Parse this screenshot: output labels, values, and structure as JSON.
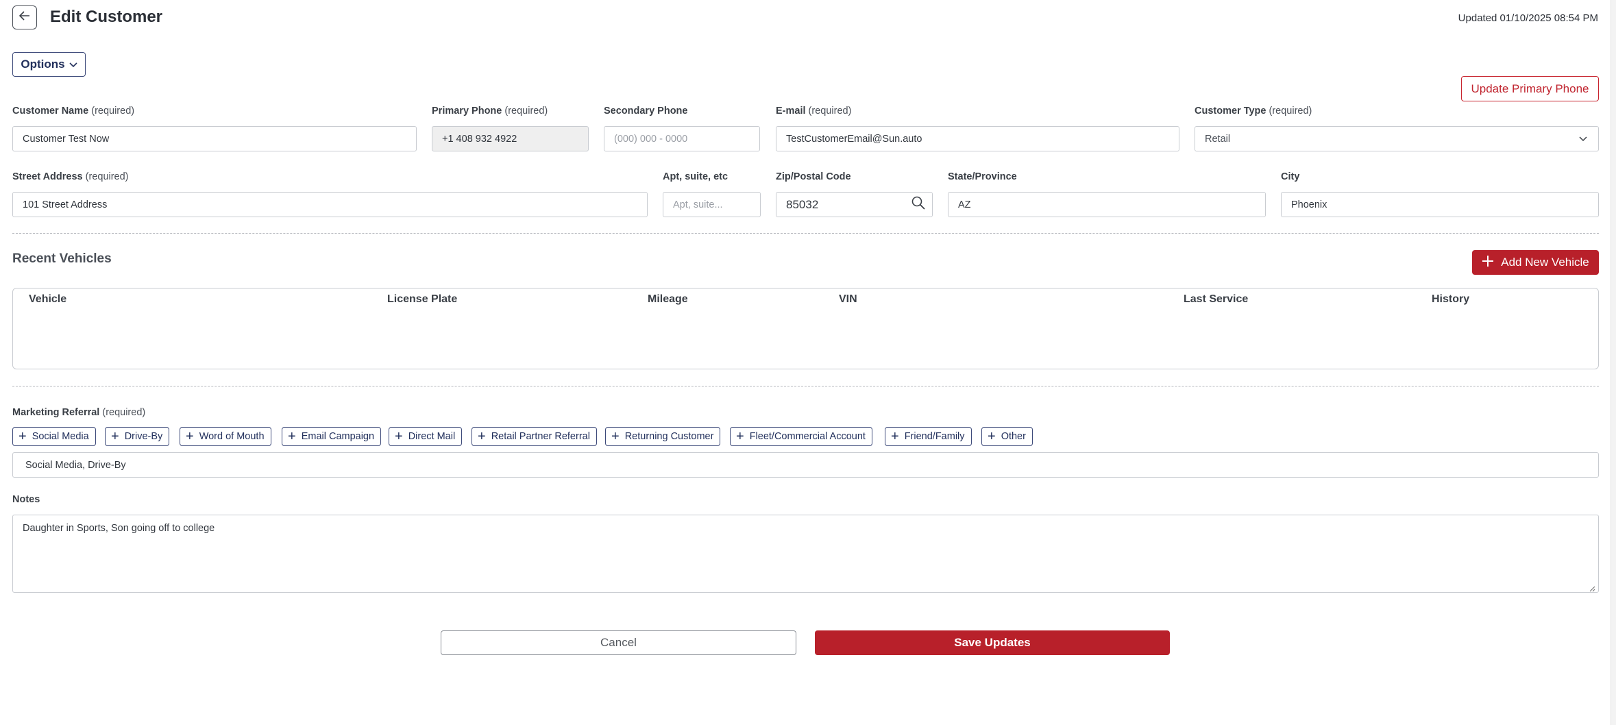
{
  "header": {
    "title": "Edit Customer",
    "updated": "Updated 01/10/2025 08:54 PM",
    "options_label": "Options",
    "update_phone_label": "Update Primary Phone"
  },
  "form": {
    "customer_name": {
      "label": "Customer Name",
      "req": "(required)",
      "value": "Customer Test Now"
    },
    "primary_phone": {
      "label": "Primary Phone",
      "req": "(required)",
      "value": "+1 408 932 4922"
    },
    "secondary_phone": {
      "label": "Secondary Phone",
      "placeholder": "(000) 000 - 0000"
    },
    "email": {
      "label": "E-mail",
      "req": "(required)",
      "value": "TestCustomerEmail@Sun.auto"
    },
    "customer_type": {
      "label": "Customer Type",
      "req": "(required)",
      "value": "Retail"
    },
    "street": {
      "label": "Street Address",
      "req": "(required)",
      "value": "101 Street Address"
    },
    "apt": {
      "label": "Apt, suite, etc",
      "placeholder": "Apt, suite..."
    },
    "zip": {
      "label": "Zip/Postal Code",
      "value": "85032"
    },
    "state": {
      "label": "State/Province",
      "value": "AZ"
    },
    "city": {
      "label": "City",
      "value": "Phoenix"
    }
  },
  "vehicles": {
    "title": "Recent Vehicles",
    "add_label": "Add New Vehicle",
    "columns": [
      "Vehicle",
      "License Plate",
      "Mileage",
      "VIN",
      "Last Service",
      "History"
    ]
  },
  "marketing": {
    "label": "Marketing Referral",
    "req": "(required)",
    "chips": [
      "Social Media",
      "Drive-By",
      "Word of Mouth",
      "Email Campaign",
      "Direct Mail",
      "Retail Partner Referral",
      "Returning Customer",
      "Fleet/Commercial Account",
      "Friend/Family",
      "Other"
    ],
    "selected": "Social Media, Drive-By"
  },
  "notes": {
    "label": "Notes",
    "value": "Daughter in Sports, Son going off to college"
  },
  "actions": {
    "cancel_label": "Cancel",
    "save_label": "Save Updates"
  },
  "colors": {
    "accent_red": "#b8202a",
    "navy": "#22305c"
  },
  "icons": {
    "back": "arrow-left-icon",
    "options": "chevron-down-icon",
    "type_select": "chevron-down-icon",
    "zip_search": "search-icon",
    "add": "plus-icon"
  }
}
